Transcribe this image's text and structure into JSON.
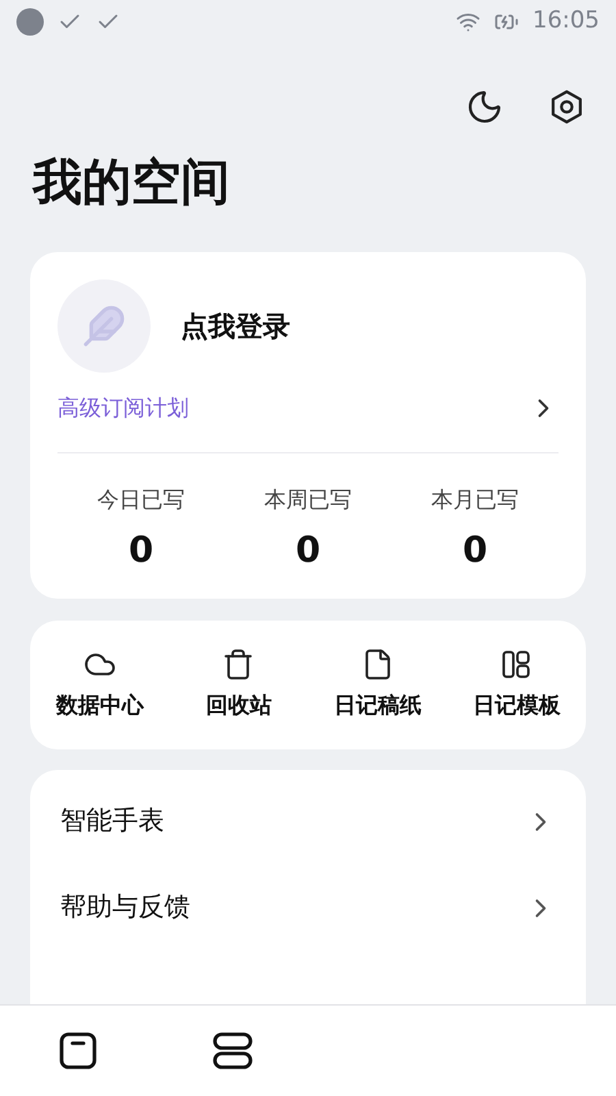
{
  "status_bar": {
    "time": "16:05"
  },
  "title": "我的空间",
  "profile": {
    "login": "点我登录",
    "subscription": "高级订阅计划"
  },
  "stats": [
    {
      "label": "今日已写",
      "value": "0"
    },
    {
      "label": "本周已写",
      "value": "0"
    },
    {
      "label": "本月已写",
      "value": "0"
    }
  ],
  "shortcuts": [
    {
      "kind": "cloud",
      "label": "数据中心"
    },
    {
      "kind": "trash",
      "label": "回收站"
    },
    {
      "kind": "paper",
      "label": "日记稿纸"
    },
    {
      "kind": "template",
      "label": "日记模板"
    }
  ],
  "menu": [
    "智能手表",
    "帮助与反馈"
  ],
  "nav": [
    {
      "kind": "diary"
    },
    {
      "kind": "list"
    }
  ]
}
